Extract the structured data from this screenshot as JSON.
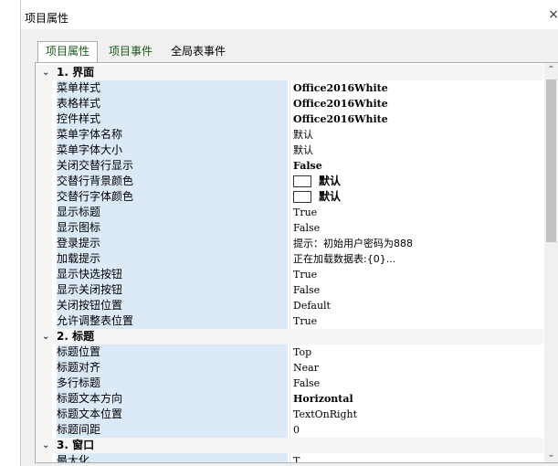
{
  "window": {
    "title": "项目属性",
    "close_glyph": "×"
  },
  "tabs": [
    {
      "label": "项目属性"
    },
    {
      "label": "项目事件"
    },
    {
      "label": "全局表事件"
    }
  ],
  "grid": {
    "categories": [
      {
        "label": "1. 界面"
      },
      {
        "label": "2. 标题"
      },
      {
        "label": "3. 窗口"
      }
    ],
    "rows": {
      "menu_style": {
        "name": "菜单样式",
        "value": "Office2016White"
      },
      "table_style": {
        "name": "表格样式",
        "value": "Office2016White"
      },
      "control_style": {
        "name": "控件样式",
        "value": "Office2016White"
      },
      "menu_font_name": {
        "name": "菜单字体名称",
        "value": "默认"
      },
      "menu_font_size": {
        "name": "菜单字体大小",
        "value": "默认"
      },
      "close_alt_rows": {
        "name": "关闭交替行显示",
        "value": "False"
      },
      "alt_row_bg": {
        "name": "交替行背景颜色",
        "value": "默认"
      },
      "alt_row_font": {
        "name": "交替行字体颜色",
        "value": "默认"
      },
      "show_title": {
        "name": "显示标题",
        "value": "True"
      },
      "show_icon": {
        "name": "显示图标",
        "value": "False"
      },
      "login_hint": {
        "name": "登录提示",
        "value": "提示：初始用户密码为888"
      },
      "load_hint": {
        "name": "加载提示",
        "value": "正在加载数据表:{0}..."
      },
      "show_quick_btn": {
        "name": "显示快选按钮",
        "value": "True"
      },
      "show_close_btn": {
        "name": "显示关闭按钮",
        "value": "False"
      },
      "close_btn_pos": {
        "name": "关闭按钮位置",
        "value": "Default"
      },
      "allow_adjust_table": {
        "name": "允许调整表位置",
        "value": "True"
      },
      "title_pos": {
        "name": "标题位置",
        "value": "Top"
      },
      "title_align": {
        "name": "标题对齐",
        "value": "Near"
      },
      "multi_title": {
        "name": "多行标题",
        "value": "False"
      },
      "title_text_dir": {
        "name": "标题文本方向",
        "value": "Horizontal"
      },
      "title_text_pos": {
        "name": "标题文本位置",
        "value": "TextOnRight"
      },
      "title_spacing": {
        "name": "标题间距",
        "value": "0"
      },
      "maximize": {
        "name": "最大化",
        "value": "T"
      }
    }
  },
  "icons": {
    "expanded": "chevron-down-icon",
    "scroll_up": "arrow-up-icon",
    "scroll_down": "arrow-down-icon"
  },
  "colors": {
    "selection": "#dce9f7",
    "tab_text": "#1c5a1c",
    "scroll_thumb": "#c1c1c1"
  }
}
